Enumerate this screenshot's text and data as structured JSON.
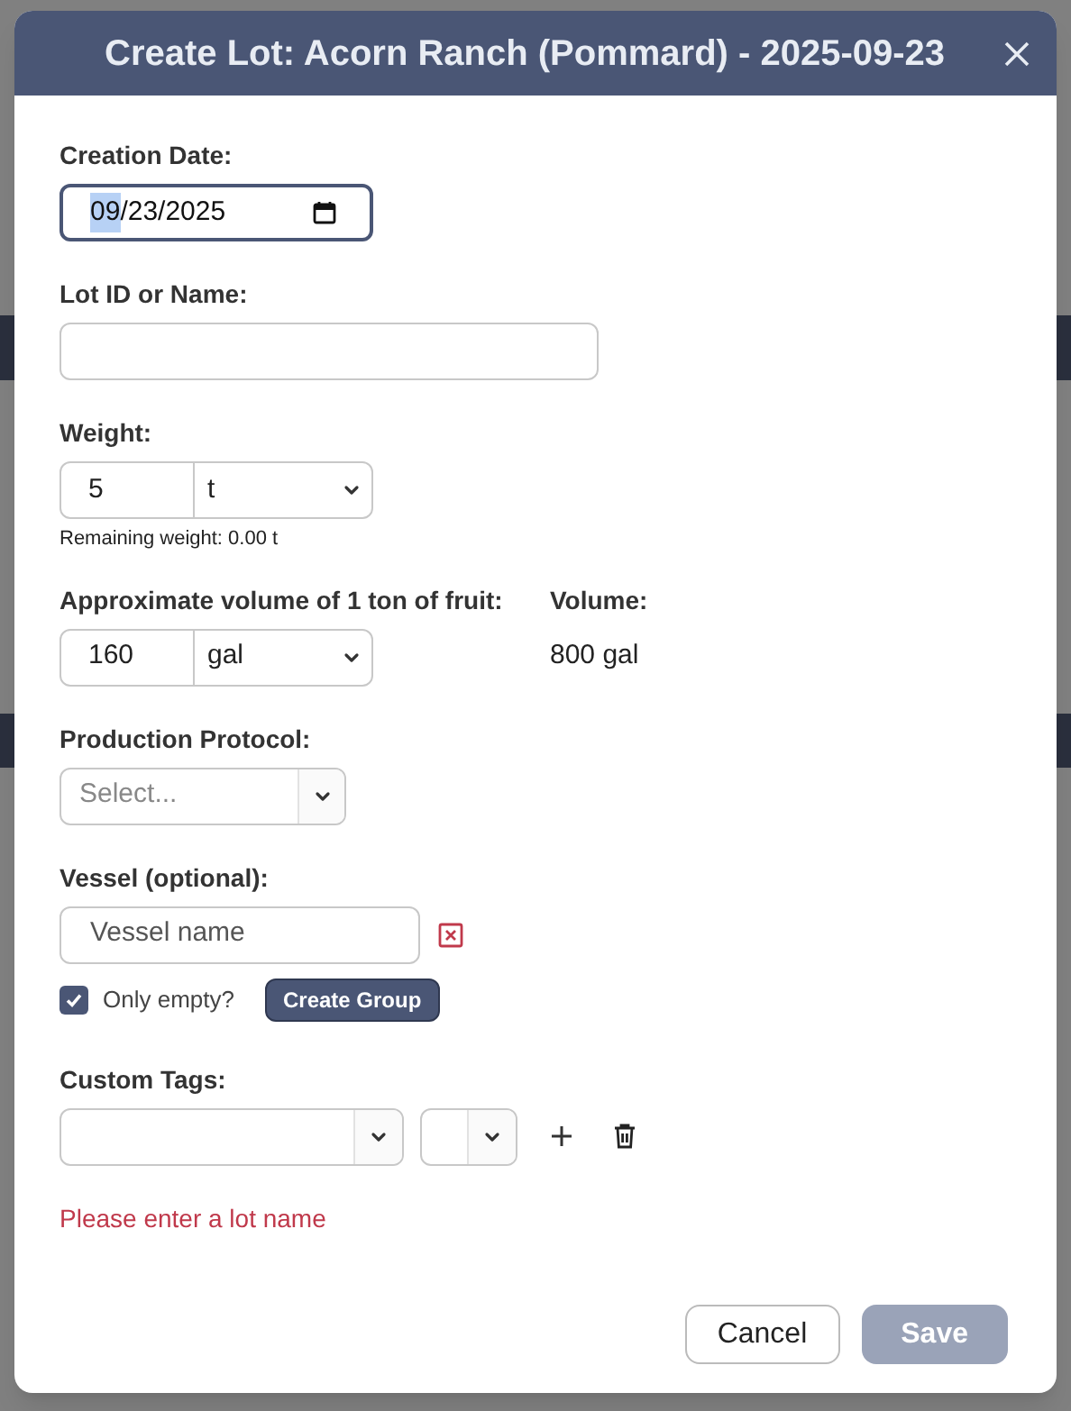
{
  "dialog": {
    "title": "Create Lot: Acorn Ranch (Pommard) - 2025-09-23"
  },
  "creation_date": {
    "label": "Creation Date:",
    "focused": true,
    "value_parts": [
      {
        "text": "09",
        "selected": true
      },
      {
        "text": "/23/2025",
        "selected": false
      }
    ]
  },
  "lot_name": {
    "label": "Lot ID or Name:"
  },
  "weight": {
    "label": "Weight:",
    "value": "5",
    "unit": "t",
    "hint": "Remaining weight: 0.00 t"
  },
  "volume_per_ton": {
    "label": "Approximate volume of 1 ton of fruit:",
    "value": "160",
    "unit": "gal"
  },
  "volume": {
    "label": "Volume:",
    "value": "800 gal"
  },
  "production_protocol": {
    "label": "Production Protocol:",
    "placeholder": "Select..."
  },
  "vessel": {
    "label": "Vessel (optional):",
    "placeholder": "Vessel name",
    "only_empty": {
      "label": "Only empty?",
      "checked": true
    },
    "create_group": "Create Group"
  },
  "custom_tags": {
    "label": "Custom Tags:"
  },
  "error": "Please enter a lot name",
  "buttons": [
    {
      "label": "Cancel",
      "kind": "secondary",
      "disabled": false
    },
    {
      "label": "Save",
      "kind": "primary",
      "disabled": true
    }
  ]
}
